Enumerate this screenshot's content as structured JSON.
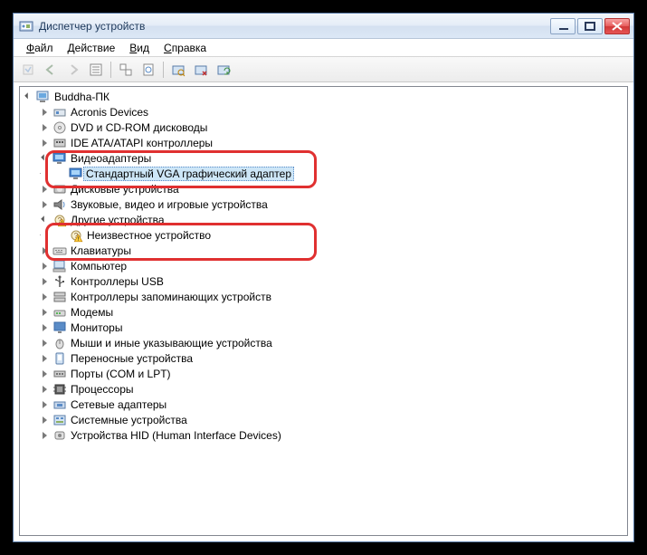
{
  "window": {
    "title": "Диспетчер устройств"
  },
  "menu": {
    "file": "Файл",
    "action": "Действие",
    "view": "Вид",
    "help": "Справка"
  },
  "tree": {
    "root": "Buddha-ПК",
    "items": [
      {
        "label": "Acronis Devices",
        "icon": "generic"
      },
      {
        "label": "DVD и CD-ROM дисководы",
        "icon": "dvd"
      },
      {
        "label": "IDE ATA/ATAPI контроллеры",
        "icon": "ide"
      },
      {
        "label": "Видеоадаптеры",
        "icon": "display",
        "expanded": true,
        "children": [
          {
            "label": "Стандартный VGA графический адаптер",
            "icon": "display",
            "selected": true
          }
        ]
      },
      {
        "label": "Дисковые устройства",
        "icon": "disk"
      },
      {
        "label": "Звуковые, видео и игровые устройства",
        "icon": "sound"
      },
      {
        "label": "Другие устройства",
        "icon": "other",
        "expanded": true,
        "warn": true,
        "children": [
          {
            "label": "Неизвестное устройство",
            "icon": "other",
            "warn": true
          }
        ]
      },
      {
        "label": "Клавиатуры",
        "icon": "keyboard"
      },
      {
        "label": "Компьютер",
        "icon": "computer"
      },
      {
        "label": "Контроллеры USB",
        "icon": "usb"
      },
      {
        "label": "Контроллеры запоминающих устройств",
        "icon": "storage"
      },
      {
        "label": "Модемы",
        "icon": "modem"
      },
      {
        "label": "Мониторы",
        "icon": "monitor"
      },
      {
        "label": "Мыши и иные указывающие устройства",
        "icon": "mouse"
      },
      {
        "label": "Переносные устройства",
        "icon": "portable"
      },
      {
        "label": "Порты (COM и LPT)",
        "icon": "ports"
      },
      {
        "label": "Процессоры",
        "icon": "cpu"
      },
      {
        "label": "Сетевые адаптеры",
        "icon": "net"
      },
      {
        "label": "Системные устройства",
        "icon": "system"
      },
      {
        "label": "Устройства HID (Human Interface Devices)",
        "icon": "hid"
      }
    ]
  }
}
